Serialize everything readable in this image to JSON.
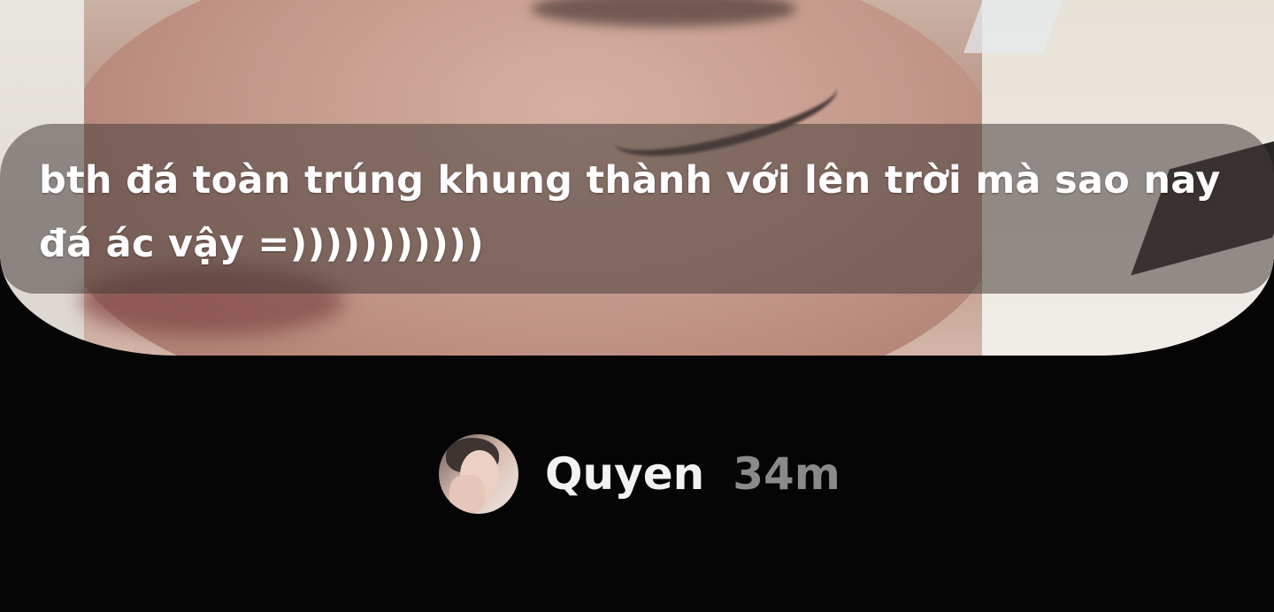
{
  "photo": {
    "icon": "photo-thumbnail"
  },
  "caption": {
    "line1": "bth đá toàn trúng khung thành với lên trời mà sao nay",
    "line2": "đá ác vậy =)))))))))))"
  },
  "author": {
    "name": "Quyen",
    "time": "34m",
    "avatar_icon": "user-avatar"
  },
  "colors": {
    "background": "#050505",
    "caption_text": "#ffffff",
    "name_text": "#f2f2f2",
    "time_text": "#8a8a8a"
  }
}
